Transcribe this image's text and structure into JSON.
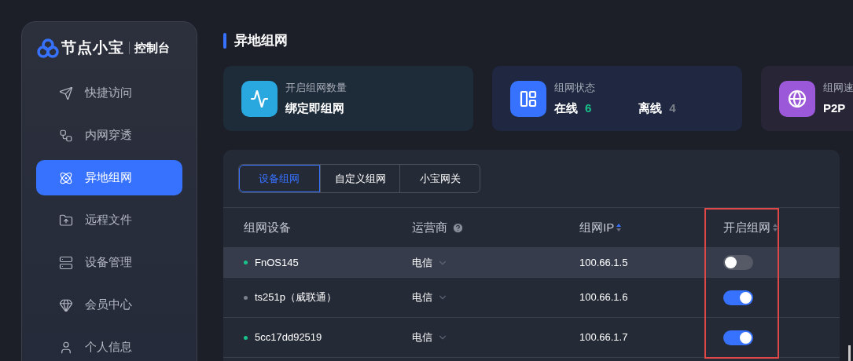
{
  "sidebar": {
    "brand": "节点小宝",
    "console": "控制台",
    "items": [
      {
        "label": "快捷访问",
        "selected": false
      },
      {
        "label": "内网穿透",
        "selected": false
      },
      {
        "label": "异地组网",
        "selected": true
      },
      {
        "label": "远程文件",
        "selected": false
      },
      {
        "label": "设备管理",
        "selected": false
      },
      {
        "label": "会员中心",
        "selected": false
      },
      {
        "label": "个人信息",
        "selected": false
      }
    ]
  },
  "page_title": "异地组网",
  "stats": [
    {
      "kind": "single",
      "label": "开启组网数量",
      "value": "绑定即组网"
    },
    {
      "kind": "status",
      "label": "组网状态",
      "online_label": "在线",
      "online": "6",
      "offline_label": "离线",
      "offline": "4"
    },
    {
      "kind": "single",
      "label": "组网速",
      "value": "P2P"
    }
  ],
  "tabs": [
    {
      "label": "设备组网",
      "selected": true
    },
    {
      "label": "自定义组网",
      "selected": false
    },
    {
      "label": "小宝网关",
      "selected": false
    }
  ],
  "table": {
    "columns": [
      "组网设备",
      "运营商",
      "组网IP",
      "开启组网"
    ],
    "rows": [
      {
        "name": "FnOS145",
        "color": "#19c28a",
        "carrier": "电信",
        "ip": "100.66.1.5",
        "enabled": false,
        "highlighted": true
      },
      {
        "name": "ts251p（威联通）",
        "color": "#7c808a",
        "carrier": "电信",
        "ip": "100.66.1.6",
        "enabled": true,
        "highlighted": false
      },
      {
        "name": "5cc17dd92519",
        "color": "#19c28a",
        "carrier": "电信",
        "ip": "100.66.1.7",
        "enabled": true,
        "highlighted": false
      }
    ]
  }
}
